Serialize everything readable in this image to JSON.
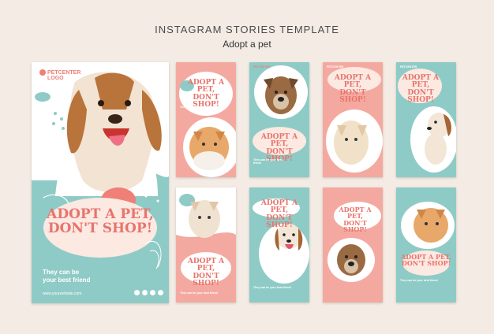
{
  "header": {
    "title": "INSTAGRAM STORIES TEMPLATE",
    "subtitle": "Adopt a pet"
  },
  "brand": {
    "logo_line1": "PETCENTER",
    "logo_line2": "LOGO"
  },
  "story": {
    "headline_line1": "ADOPT A PET,",
    "headline_line2": "DON'T SHOP!",
    "tagline_line1": "They can be",
    "tagline_line2": "your best friend",
    "tagline_short": "They can be your best friend",
    "website": "www.yourwebsite.com"
  },
  "colors": {
    "pink": "#f4a9a0",
    "teal": "#8fcbc6",
    "coral": "#e8746c",
    "cream": "#f4ece4"
  },
  "icons": [
    "dog-photo-icon",
    "cat-photo-icon",
    "instagram-icon",
    "facebook-icon",
    "twitter-icon"
  ]
}
